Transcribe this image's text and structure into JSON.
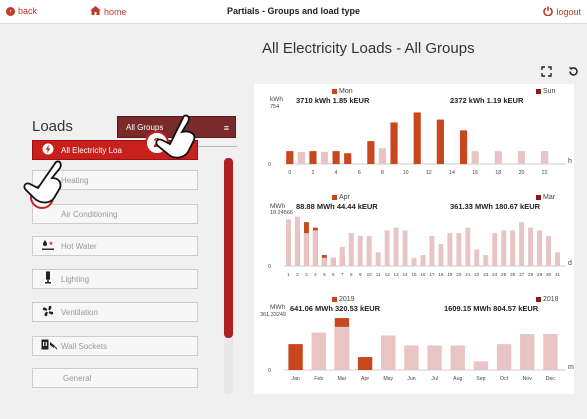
{
  "topbar": {
    "back": "back",
    "home": "home",
    "title": "Partials - Groups and load type",
    "logout": "logout"
  },
  "page_title": "All Electricity Loads - All Groups",
  "loads_title": "Loads",
  "group_select": {
    "value": "All Groups",
    "menu_icon": "hamburger-icon"
  },
  "loads": [
    {
      "label": "All Electricity Loa",
      "icon": "lightning-icon",
      "active": true
    },
    {
      "label": "Heating",
      "icon": "heating-icon",
      "active": false
    },
    {
      "label": "Air Conditioning",
      "icon": "snowflake-icon",
      "active": false
    },
    {
      "label": "Hot Water",
      "icon": "hot-water-icon",
      "active": false
    },
    {
      "label": "Lighting",
      "icon": "lamp-icon",
      "active": false
    },
    {
      "label": "Ventilation",
      "icon": "fan-icon",
      "active": false
    },
    {
      "label": "Wall Sockets",
      "icon": "socket-icon",
      "active": false
    },
    {
      "label": "General",
      "icon": "",
      "active": false
    }
  ],
  "callouts": [
    "2",
    "3"
  ],
  "colors": {
    "current": "#c8471d",
    "previous": "#e8c4c4",
    "accent": "#c8201d"
  },
  "chart_data": [
    {
      "type": "bar",
      "unit": "kWh",
      "ymax_label": "754",
      "axis_end": "h",
      "ylim": [
        0,
        754
      ],
      "legend_current": "Mon",
      "legend_previous": "Sun",
      "summary_current": "3710 kWh 1.85 kEUR",
      "summary_previous": "2372 kWh 1.19 kEUR",
      "categories": [
        "0",
        "1",
        "2",
        "3",
        "4",
        "5",
        "6",
        "7",
        "8",
        "9",
        "10",
        "11",
        "12",
        "13",
        "14",
        "15",
        "16",
        "17",
        "18",
        "19",
        "20",
        "21",
        "22",
        "23"
      ],
      "tick_labels": [
        "0",
        "2",
        "4",
        "6",
        "8",
        "10",
        "12",
        "14",
        "16",
        "18",
        "20",
        "22"
      ],
      "series": [
        {
          "name": "Mon",
          "values": [
            180,
            0,
            180,
            0,
            180,
            150,
            0,
            320,
            0,
            580,
            0,
            720,
            0,
            620,
            0,
            470,
            0,
            0,
            0,
            0,
            0,
            0,
            0,
            0
          ]
        },
        {
          "name": "Sun",
          "values": [
            0,
            170,
            0,
            170,
            0,
            0,
            0,
            0,
            220,
            0,
            0,
            0,
            0,
            0,
            0,
            0,
            180,
            0,
            180,
            0,
            180,
            0,
            180,
            0
          ]
        }
      ]
    },
    {
      "type": "bar",
      "unit": "MWh",
      "ymax_label": "18.24566",
      "axis_end": "d",
      "ylim": [
        0,
        18.24566
      ],
      "legend_current": "Apr",
      "legend_previous": "Mar",
      "summary_current": "88.88 MWh 44.44 kEUR",
      "summary_previous": "361.33 MWh 180.67 kEUR",
      "categories": [
        "1",
        "2",
        "3",
        "4",
        "5",
        "6",
        "7",
        "8",
        "9",
        "10",
        "11",
        "12",
        "13",
        "14",
        "15",
        "16",
        "17",
        "18",
        "19",
        "20",
        "21",
        "22",
        "23",
        "24",
        "25",
        "26",
        "27",
        "28",
        "29",
        "30",
        "31"
      ],
      "tick_labels": [
        "1",
        "2",
        "3",
        "4",
        "5",
        "6",
        "7",
        "8",
        "9",
        "10",
        "11",
        "12",
        "13",
        "14",
        "15",
        "16",
        "17",
        "18",
        "19",
        "20",
        "21",
        "22",
        "23",
        "24",
        "25",
        "26",
        "27",
        "28",
        "29",
        "30",
        "31"
      ],
      "series": [
        {
          "name": "Apr",
          "values": [
            14,
            14,
            16,
            14,
            4,
            3,
            4,
            0,
            0,
            0,
            0,
            0,
            0,
            0,
            0,
            0,
            0,
            0,
            0,
            0,
            0,
            0,
            0,
            0,
            0,
            0,
            0,
            0,
            0,
            0,
            0
          ]
        },
        {
          "name": "Mar",
          "values": [
            17,
            18,
            12,
            13,
            3,
            3,
            7,
            12,
            11,
            11,
            5,
            13,
            14,
            13,
            3,
            4,
            11,
            8,
            12,
            12,
            14,
            6,
            4,
            12,
            13,
            13,
            16,
            14,
            13,
            11,
            5
          ]
        }
      ]
    },
    {
      "type": "bar",
      "unit": "MWh",
      "ymax_label": "361.33249",
      "axis_end": "m",
      "ylim": [
        0,
        361.33249
      ],
      "legend_current": "2019",
      "legend_previous": "2018",
      "summary_current": "641.06 MWh 320.53 kEUR",
      "summary_previous": "1609.15 MWh 804.57 kEUR",
      "categories": [
        "Jan",
        "Feb",
        "Mar",
        "Apr",
        "May",
        "Jun",
        "Jul",
        "Aug",
        "Sep",
        "Oct",
        "Nov",
        "Dec"
      ],
      "tick_labels": [
        "Jan",
        "Feb",
        "Mar",
        "Apr",
        "May",
        "Jun",
        "Jul",
        "Aug",
        "Sep",
        "Oct",
        "Nov",
        "Dec"
      ],
      "series": [
        {
          "name": "2019",
          "values": [
            180,
            0,
            361,
            90,
            0,
            0,
            0,
            0,
            0,
            0,
            0,
            0
          ]
        },
        {
          "name": "2018",
          "values": [
            0,
            260,
            300,
            0,
            240,
            170,
            170,
            170,
            60,
            180,
            250,
            250
          ]
        }
      ]
    }
  ]
}
